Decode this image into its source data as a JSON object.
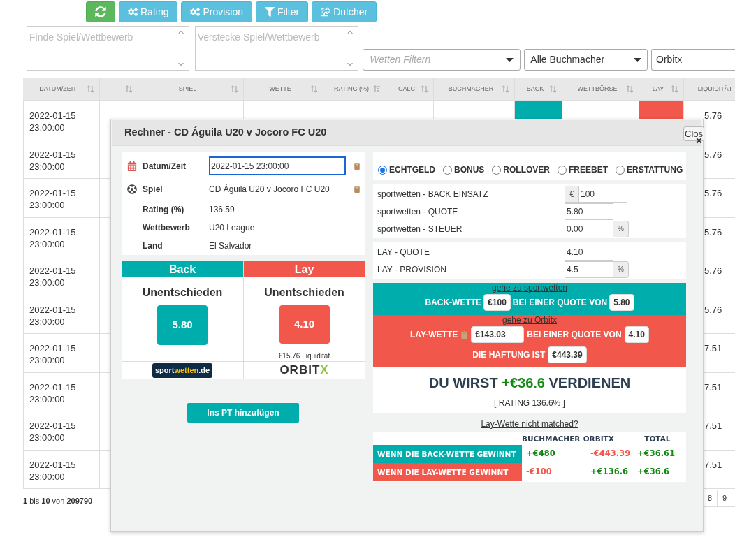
{
  "toolbar": {
    "buttons": [
      {
        "kind": "refresh"
      },
      {
        "kind": "gears",
        "label": "Rating"
      },
      {
        "kind": "gears",
        "label": "Provision"
      },
      {
        "kind": "filter",
        "label": "Filter"
      },
      {
        "kind": "share",
        "label": "Dutcher"
      }
    ]
  },
  "filters": {
    "search_placeholder": "Finde Spiel/Wettbewerb",
    "hide_placeholder": "Verstecke Spiel/Wettbewerb",
    "bet_filter_placeholder": "Wetten Filtern",
    "bookmaker_select": "Alle Buchmacher",
    "exchange_select": "Orbitx"
  },
  "table": {
    "columns": [
      {
        "label": "DATUM/ZEIT",
        "kind": "plain",
        "sorted": false
      },
      {
        "kind": "plain",
        "sorted": false
      },
      {
        "label": "SPIEL",
        "kind": "plain",
        "sorted": false
      },
      {
        "label": "WETTE",
        "kind": "plain",
        "sorted": false
      },
      {
        "label": "RATING (%)",
        "kind": "plain",
        "sorted": true
      },
      {
        "label": "CALC",
        "kind": "plain",
        "sorted": false
      },
      {
        "label": "BUCHMACHER",
        "kind": "plain",
        "sorted": false
      },
      {
        "label": "BACK",
        "kind": "back",
        "sorted": false
      },
      {
        "label": "WETTBÖRSE",
        "kind": "plain",
        "sorted": false
      },
      {
        "label": "LAY",
        "kind": "lay",
        "sorted": false
      },
      {
        "label": "LIQUIDITÄT",
        "kind": "plain"
      }
    ],
    "rows": [
      {
        "datetime": "2022-01-15 23:00:00",
        "liquidity": "5.76"
      },
      {
        "datetime": "2022-01-15 23:00:00",
        "liquidity": "5.76"
      },
      {
        "datetime": "2022-01-15 23:00:00",
        "liquidity": "5.76"
      },
      {
        "datetime": "2022-01-15 23:00:00",
        "liquidity": "5.76"
      },
      {
        "datetime": "2022-01-15 23:00:00",
        "liquidity": "5.76"
      },
      {
        "datetime": "2022-01-15 23:00:00",
        "liquidity": "5.76"
      },
      {
        "datetime": "2022-01-15 23:00:00",
        "liquidity": "7.51"
      },
      {
        "datetime": "2022-01-15 23:00:00",
        "liquidity": "7.51"
      },
      {
        "datetime": "2022-01-15 23:00:00",
        "liquidity": "7.51"
      },
      {
        "datetime": "2022-01-15 23:00:00",
        "liquidity": "7.51"
      }
    ]
  },
  "footer": {
    "range_text": "**1** bis **10** von **209790**",
    "pages": [
      "8",
      "9"
    ]
  },
  "dialog": {
    "title": "Rechner - CD Águila U20 v Jocoro FC U20",
    "close_label": "Clos",
    "info": [
      {
        "kind": "date",
        "label": "Datum/Zeit",
        "value": "2022-01-15 23:00:00"
      },
      {
        "kind": "game",
        "label": "Spiel",
        "value": "CD Águila U20 v Jocoro FC U20"
      },
      {
        "kind": "plain",
        "label": "Rating (%)",
        "value": "136.59"
      },
      {
        "kind": "plain",
        "label": "Wettbewerb",
        "value": "U20 League"
      },
      {
        "kind": "plain",
        "label": "Land",
        "value": "El Salvador"
      }
    ],
    "back": {
      "header": "Back",
      "outcome": "Unentschieden",
      "odds": "5.80",
      "logo": [
        "sport",
        "wetten",
        ".de"
      ]
    },
    "lay": {
      "header": "Lay",
      "outcome": "Unentschieden",
      "odds": "4.10",
      "liquidity": "€15.76 Liquidität",
      "logo": [
        "ORBIT",
        "X"
      ]
    },
    "add_button": "Ins PT hinzufügen",
    "bet_types": [
      {
        "label": "ECHTGELD",
        "selected": true
      },
      {
        "label": "BONUS",
        "selected": false
      },
      {
        "label": "ROLLOVER",
        "selected": false
      },
      {
        "label": "FREEBET",
        "selected": false
      },
      {
        "label": "ERSTATTUNG",
        "selected": false
      }
    ],
    "back_fields": [
      {
        "label": "sportwetten - BACK EINSATZ",
        "value": "100",
        "prefix": "€"
      },
      {
        "label": "sportwetten - QUOTE",
        "value": "5.80"
      },
      {
        "label": "sportwetten - STEUER",
        "value": "0.00",
        "suffix": "%"
      }
    ],
    "lay_fields": [
      {
        "label": "LAY - QUOTE",
        "value": "4.10"
      },
      {
        "label": "LAY - PROVISION",
        "value": "4.5",
        "suffix": "%"
      }
    ],
    "back_bet": {
      "link": "gehe zu sportwetten",
      "label": "BACK-WETTE",
      "stake": "€100",
      "odds_label": "BEI EINER QUOTE VON",
      "odds": "5.80"
    },
    "lay_bet": {
      "link": "gehe zu Orbitx",
      "label": "LAY-WETTE",
      "stake": "€143.03",
      "odds_label": "BEI EINER QUOTE VON",
      "odds": "4.10",
      "liability_label": "DIE HAFTUNG IST",
      "liability": "€443.39"
    },
    "result": {
      "prefix": "DU WIRST",
      "profit": "+€36.6",
      "suffix": "VERDIENEN",
      "rating": "[ RATING 136.6% ]"
    },
    "unmatched_link": "Lay-Wette nicht matched?",
    "outcomes": {
      "columns": [
        "BUCHMACHER",
        "ORBITX",
        "TOTAL"
      ],
      "rows": [
        {
          "kind": "back",
          "label": "WENN DIE BACK-WETTE GEWINNT",
          "values": [
            {
              "text": "+€480",
              "kind": "gain"
            },
            {
              "text": "-€443.39",
              "kind": "loss"
            },
            {
              "text": "+€36.61",
              "kind": "gain"
            }
          ]
        },
        {
          "kind": "lay",
          "label": "WENN DIE LAY-WETTE GEWINNT",
          "values": [
            {
              "text": "-€100",
              "kind": "loss"
            },
            {
              "text": "+€136.6",
              "kind": "gain"
            },
            {
              "text": "+€36.6",
              "kind": "gain"
            }
          ]
        }
      ]
    }
  }
}
